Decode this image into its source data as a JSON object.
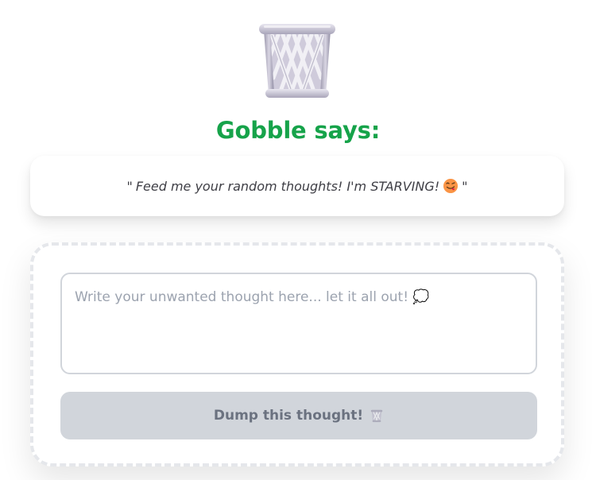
{
  "mascot": {
    "icon": "wastebasket-icon",
    "title": "Gobble says:"
  },
  "speech": {
    "quote_open": "\"",
    "text": "Feed me your random thoughts! I'm STARVING!",
    "emoji": "face-with-tongue-icon",
    "quote_close": "\""
  },
  "thought_form": {
    "placeholder": "Write your unwanted thought here... let it all out! 💭",
    "value": "",
    "submit_label": "Dump this thought!",
    "submit_icon": "wastebasket-icon",
    "submit_state": "disabled"
  },
  "colors": {
    "title_green": "#16a34a",
    "button_disabled_bg": "#d1d5db",
    "button_disabled_text": "#6b7280",
    "dashed_border": "#e5e7eb"
  }
}
